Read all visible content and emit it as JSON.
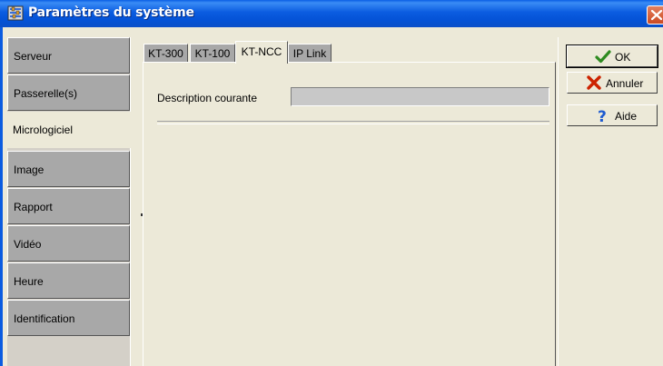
{
  "window": {
    "title": "Paramètres du système"
  },
  "sidebar": {
    "items": [
      {
        "label": "Serveur",
        "active": false
      },
      {
        "label": "Passerelle(s)",
        "active": false
      },
      {
        "label": "Micrologiciel",
        "active": true
      },
      {
        "label": "Image",
        "active": false
      },
      {
        "label": "Rapport",
        "active": false
      },
      {
        "label": "Vidéo",
        "active": false
      },
      {
        "label": "Heure",
        "active": false
      },
      {
        "label": "Identification",
        "active": false
      }
    ]
  },
  "tabs": [
    {
      "label": "KT-300",
      "active": false
    },
    {
      "label": "KT-100",
      "active": false
    },
    {
      "label": "KT-NCC",
      "active": true
    },
    {
      "label": "IP Link",
      "active": false
    }
  ],
  "panel": {
    "description_label": "Description courante",
    "description_value": ""
  },
  "buttons": {
    "ok": "OK",
    "cancel": "Annuler",
    "help": "Aide"
  },
  "colors": {
    "titlebar": "#0b5ce0",
    "inactive_item": "#a8a8a8",
    "face": "#ece9d8",
    "ok_check": "#2e8b20",
    "cancel_x": "#cc2200",
    "help_q": "#1e5bd0"
  },
  "icons": {
    "title": "settings-window-icon",
    "close": "close-icon",
    "ok": "checkmark-icon",
    "cancel": "x-icon",
    "help": "question-mark-icon"
  }
}
